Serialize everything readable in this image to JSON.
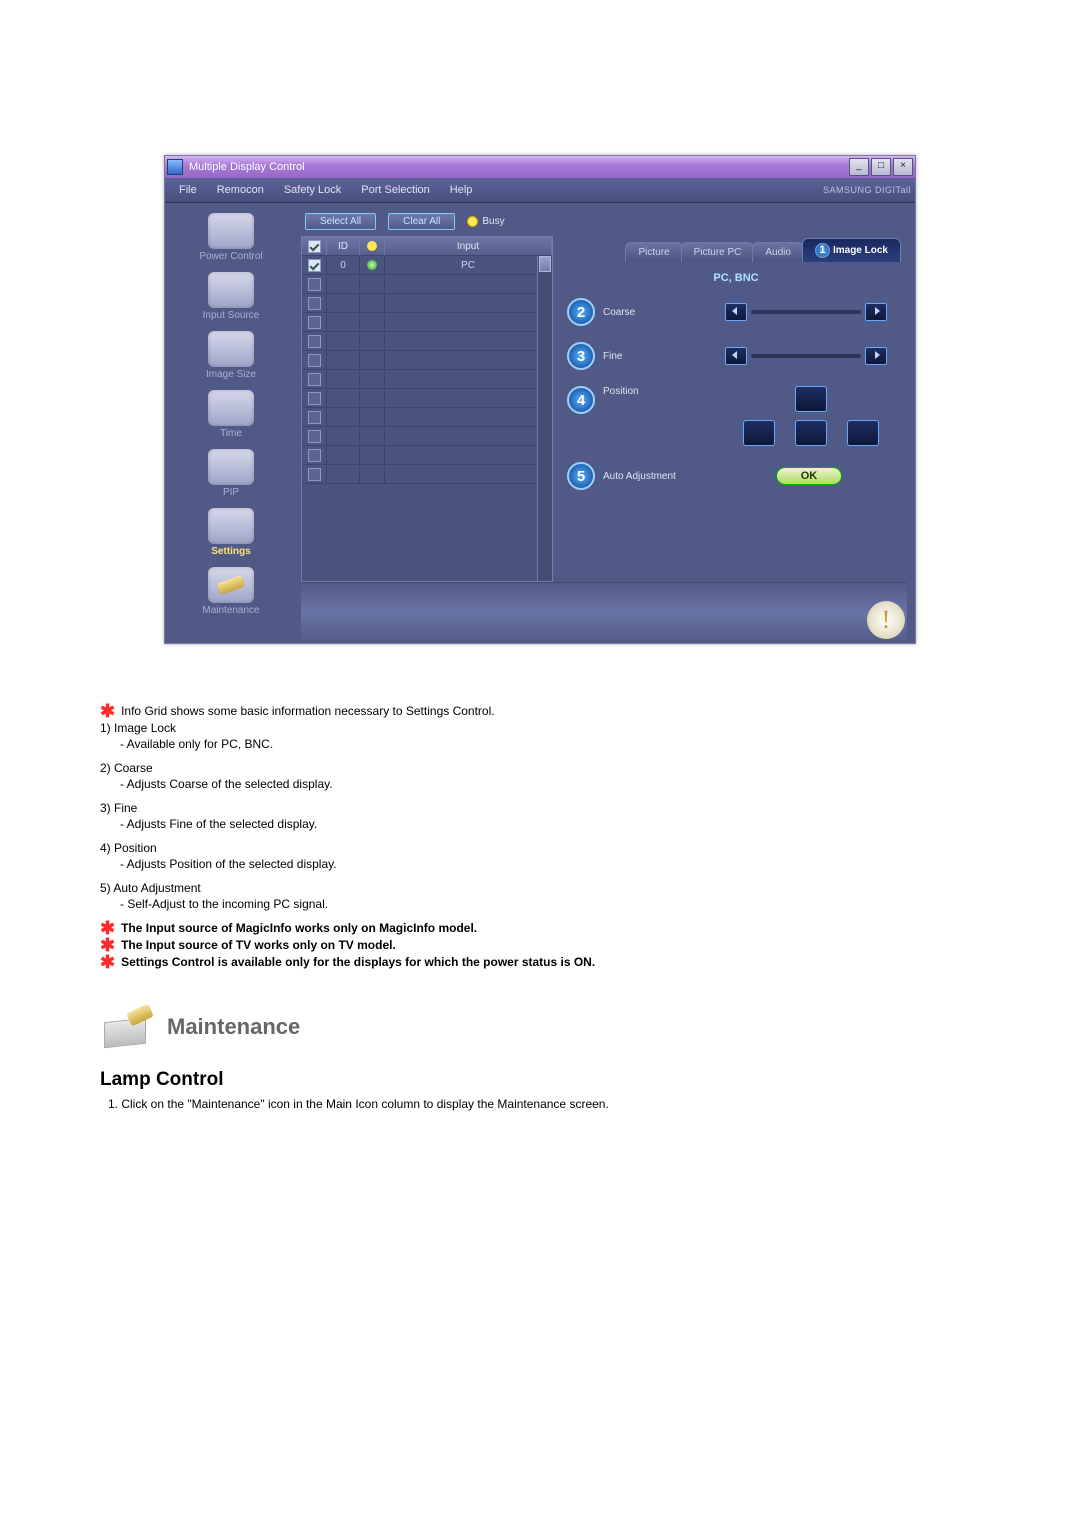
{
  "window": {
    "title": "Multiple Display Control",
    "brand": "SAMSUNG DIGITall"
  },
  "menubar": [
    "File",
    "Remocon",
    "Safety Lock",
    "Port Selection",
    "Help"
  ],
  "sidebar": [
    {
      "label": "Power Control"
    },
    {
      "label": "Input Source"
    },
    {
      "label": "Image Size"
    },
    {
      "label": "Time"
    },
    {
      "label": "PIP"
    },
    {
      "label": "Settings"
    },
    {
      "label": "Maintenance"
    }
  ],
  "toolbar": {
    "select_all": "Select All",
    "clear_all": "Clear All",
    "busy": "Busy"
  },
  "grid": {
    "head_check": "✓",
    "head_id": "ID",
    "head_status": " ",
    "head_input": "Input",
    "rows": [
      {
        "checked": true,
        "id": "0",
        "status": "g",
        "input": "PC"
      },
      {
        "checked": false,
        "id": "",
        "status": "",
        "input": ""
      },
      {
        "checked": false,
        "id": "",
        "status": "",
        "input": ""
      },
      {
        "checked": false,
        "id": "",
        "status": "",
        "input": ""
      },
      {
        "checked": false,
        "id": "",
        "status": "",
        "input": ""
      },
      {
        "checked": false,
        "id": "",
        "status": "",
        "input": ""
      },
      {
        "checked": false,
        "id": "",
        "status": "",
        "input": ""
      },
      {
        "checked": false,
        "id": "",
        "status": "",
        "input": ""
      },
      {
        "checked": false,
        "id": "",
        "status": "",
        "input": ""
      },
      {
        "checked": false,
        "id": "",
        "status": "",
        "input": ""
      },
      {
        "checked": false,
        "id": "",
        "status": "",
        "input": ""
      },
      {
        "checked": false,
        "id": "",
        "status": "",
        "input": ""
      }
    ]
  },
  "settings": {
    "tabs": {
      "picture": "Picture",
      "picture_pc": "Picture PC",
      "audio": "Audio",
      "image_lock": "Image Lock",
      "image_lock_marker": "1"
    },
    "source_banner": "PC, BNC",
    "coarse_marker": "2",
    "coarse_label": "Coarse",
    "fine_marker": "3",
    "fine_label": "Fine",
    "position_marker": "4",
    "position_label": "Position",
    "auto_marker": "5",
    "auto_label": "Auto Adjustment",
    "ok": "OK"
  },
  "notes": {
    "info": "Info Grid shows some basic information necessary to Settings Control.",
    "n1": "1)  Image Lock",
    "n1s": "- Available only for PC, BNC.",
    "n2": "2)  Coarse",
    "n2s": "- Adjusts Coarse of the selected display.",
    "n3": "3)  Fine",
    "n3s": "- Adjusts Fine of the selected display.",
    "n4": "4)  Position",
    "n4s": "- Adjusts Position of the selected display.",
    "n5": "5)  Auto Adjustment",
    "n5s": "- Self-Adjust to the incoming PC signal.",
    "b1": "The Input source of MagicInfo works only on MagicInfo model.",
    "b2": "The Input source of TV works only on TV model.",
    "b3": "Settings Control is available only for the displays for which the power status is ON."
  },
  "maintenance": {
    "heading": "Maintenance",
    "sub_heading": "Lamp Control",
    "step1": "1.  Click on the \"Maintenance\" icon in the Main Icon column to display the Maintenance screen."
  }
}
